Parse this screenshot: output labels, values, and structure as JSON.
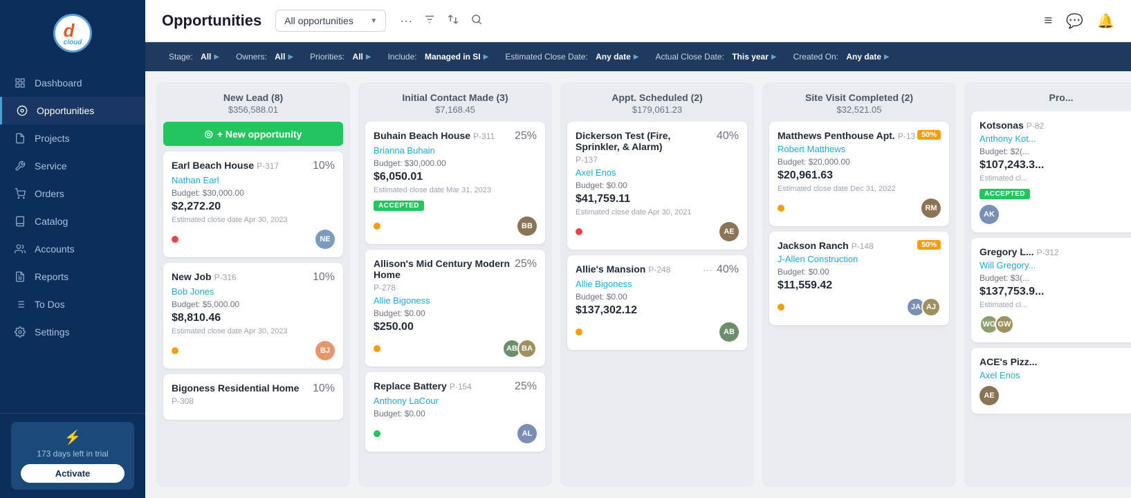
{
  "sidebar": {
    "logo": {
      "letter": "d",
      "sub": "cloud"
    },
    "items": [
      {
        "id": "dashboard",
        "label": "Dashboard",
        "icon": "⊞",
        "active": false
      },
      {
        "id": "opportunities",
        "label": "Opportunities",
        "icon": "◎",
        "active": true
      },
      {
        "id": "projects",
        "label": "Projects",
        "icon": "⚙",
        "active": false
      },
      {
        "id": "service",
        "label": "Service",
        "icon": "🔧",
        "active": false
      },
      {
        "id": "orders",
        "label": "Orders",
        "icon": "🛒",
        "active": false
      },
      {
        "id": "catalog",
        "label": "Catalog",
        "icon": "📖",
        "active": false
      },
      {
        "id": "accounts",
        "label": "Accounts",
        "icon": "👤",
        "active": false
      },
      {
        "id": "reports",
        "label": "Reports",
        "icon": "📋",
        "active": false
      },
      {
        "id": "todos",
        "label": "To Dos",
        "icon": "☰",
        "active": false
      },
      {
        "id": "settings",
        "label": "Settings",
        "icon": "⚙",
        "active": false
      }
    ],
    "trial": {
      "days": "173 days left in trial",
      "activate": "Activate"
    }
  },
  "header": {
    "title": "Opportunities",
    "dropdown": {
      "label": "All opportunities"
    },
    "icons": {
      "more": "···",
      "filter": "⊟",
      "sort": "↑↓",
      "search": "🔍"
    },
    "right_icons": {
      "menu": "≡",
      "chat": "💬",
      "bell": "🔔"
    }
  },
  "filter_bar": {
    "filters": [
      {
        "label": "Stage:",
        "value": "All"
      },
      {
        "label": "Owners:",
        "value": "All"
      },
      {
        "label": "Priorities:",
        "value": "All"
      },
      {
        "label": "Include:",
        "value": "Managed in SI"
      },
      {
        "label": "Estimated Close Date:",
        "value": "Any date"
      },
      {
        "label": "Actual Close Date:",
        "value": "This year"
      },
      {
        "label": "Created On:",
        "value": "Any date"
      }
    ]
  },
  "columns": [
    {
      "title": "New Lead (8)",
      "amount": "$356,588.01",
      "show_new_btn": true,
      "new_btn_label": "+ New opportunity",
      "cards": [
        {
          "title": "Earl Beach House",
          "project": "P-317",
          "contact": "Nathan Earl",
          "percent": "10%",
          "budget_label": "Budget: $30,000.00",
          "amount": "$2,272.20",
          "close_date": "Estimated close date   Apr 30, 2023",
          "dot": "red",
          "avatar_initials": "NE",
          "avatar_color": "#7c9cbf",
          "badge": null
        },
        {
          "title": "New Job",
          "project": "P-316",
          "contact": "Bob Jones",
          "percent": "10%",
          "budget_label": "Budget: $5,000.00",
          "amount": "$8,810.46",
          "close_date": "Estimated close date   Apr 30, 2023",
          "dot": "yellow",
          "avatar_initials": "BJ",
          "avatar_color": "#e8956d",
          "badge": null
        },
        {
          "title": "Bigoness Residential Home",
          "project": "P-308",
          "contact": "",
          "percent": "10%",
          "budget_label": "",
          "amount": "",
          "close_date": "",
          "dot": null,
          "avatar_initials": "",
          "avatar_color": "",
          "badge": null
        }
      ]
    },
    {
      "title": "Initial Contact Made (3)",
      "amount": "$7,168.45",
      "show_new_btn": false,
      "cards": [
        {
          "title": "Buhain Beach House",
          "project": "P-311",
          "contact": "Brianna Buhain",
          "percent": "25%",
          "budget_label": "Budget: $30,000.00",
          "amount": "$6,050.01",
          "close_date": "Estimated close date   Mar 31, 2023",
          "dot": "yellow",
          "avatar_initials": "BB",
          "avatar_color": "#8b7355",
          "badge": "ACCEPTED"
        },
        {
          "title": "Allison's Mid Century Modern Home",
          "project": "P-278",
          "contact": "Allie Bigoness",
          "percent": "25%",
          "budget_label": "Budget: $0.00",
          "amount": "$250.00",
          "close_date": "",
          "dot": "yellow",
          "avatar_initials": "AB",
          "avatar_color": "#6b8e6b",
          "badge": null,
          "avatar2": true
        },
        {
          "title": "Replace Battery",
          "project": "P-154",
          "contact": "Anthony LaCour",
          "percent": "25%",
          "budget_label": "Budget: $0.00",
          "amount": "",
          "close_date": "",
          "dot": "green",
          "avatar_initials": "AL",
          "avatar_color": "#7a8fb5",
          "badge": null
        }
      ]
    },
    {
      "title": "Appt. Scheduled (2)",
      "amount": "$179,061.23",
      "show_new_btn": false,
      "cards": [
        {
          "title": "Dickerson Test (Fire, Sprinkler, & Alarm)",
          "project": "P-137",
          "contact": "Axel Enos",
          "percent": "40%",
          "budget_label": "Budget: $0.00",
          "amount": "$41,759.11",
          "close_date": "Estimated close date   Apr 30, 2021",
          "dot": "red",
          "avatar_initials": "AE",
          "avatar_color": "#8b7355",
          "badge": null
        },
        {
          "title": "Allie's Mansion",
          "project": "P-248",
          "contact": "Allie Bigoness",
          "percent": "40%",
          "budget_label": "Budget: $0.00",
          "amount": "$137,302.12",
          "close_date": "",
          "dot": "yellow",
          "avatar_initials": "AB",
          "avatar_color": "#6b8e6b",
          "badge": null,
          "show_more": true
        }
      ]
    },
    {
      "title": "Site Visit Completed (2)",
      "amount": "$32,521.05",
      "show_new_btn": false,
      "cards": [
        {
          "title": "Matthews Penthouse Apt.",
          "project": "P-13",
          "contact": "Robert Matthews",
          "percent": "50%",
          "budget_label": "Budget: $20,000.00",
          "amount": "$20,961.63",
          "close_date": "Estimated close date   Dec 31, 2022",
          "dot": "yellow",
          "avatar_initials": "RM",
          "avatar_color": "#8b7355",
          "badge": null,
          "percent_badge_yellow": true
        },
        {
          "title": "Jackson Ranch",
          "project": "P-148",
          "contact": "J-Allen Construction",
          "percent": "50%",
          "budget_label": "Budget: $0.00",
          "amount": "$11,559.42",
          "close_date": "",
          "dot": "yellow",
          "avatar_initials": "JA",
          "avatar_color": "#7a8fb5",
          "badge": null,
          "avatar2": true,
          "percent_badge_yellow": true
        }
      ]
    },
    {
      "title": "Pro...",
      "amount": "",
      "partial": true,
      "show_new_btn": false,
      "cards": [
        {
          "title": "Kotsonas",
          "project": "P-82",
          "contact": "Anthony Kot...",
          "percent": "",
          "budget_label": "Budget: $2(...",
          "amount": "$107,243.3...",
          "close_date": "Estimated cl...",
          "dot": null,
          "avatar_initials": "AK",
          "avatar_color": "#7a8fb5",
          "badge": "ACCEPTED"
        },
        {
          "title": "Gregory L...",
          "project": "P-312",
          "contact": "Will Gregory...",
          "percent": "",
          "budget_label": "Budget: $3(...",
          "amount": "$137,753.9...",
          "close_date": "Estimated cl...",
          "dot": null,
          "avatar_initials": "WG",
          "avatar_color": "#8b9e6e",
          "badge": null,
          "avatar2": true
        },
        {
          "title": "ACE's Pizz...",
          "project": "",
          "contact": "Axel Enos",
          "percent": "",
          "budget_label": "",
          "amount": "",
          "close_date": "",
          "dot": null,
          "avatar_initials": "AE",
          "avatar_color": "#8b7355",
          "badge": null
        }
      ]
    }
  ]
}
